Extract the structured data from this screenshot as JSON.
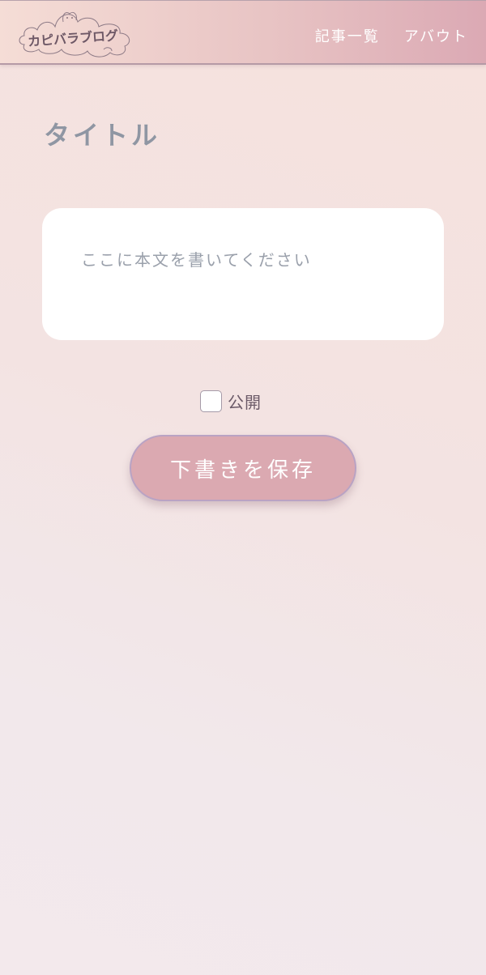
{
  "header": {
    "logo_text": "カピバラブログ",
    "nav": [
      {
        "label": "記事一覧"
      },
      {
        "label": "アバウト"
      }
    ]
  },
  "editor": {
    "title_placeholder": "タイトル",
    "body_placeholder": "ここに本文を書いてください",
    "publish_label": "公開",
    "publish_checked": false,
    "save_label": "下書きを保存"
  },
  "colors": {
    "accent": "#dba9b1",
    "title_text": "#8f96a3",
    "header_end": "#dba9b4"
  }
}
